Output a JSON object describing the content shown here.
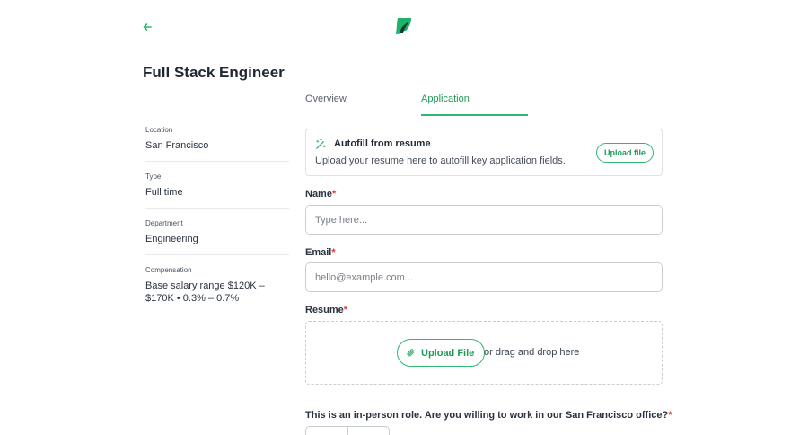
{
  "header": {
    "back_icon": "arrow-left-icon",
    "logo_icon": "brand-logo-icon",
    "accent_color": "#2eb872"
  },
  "job": {
    "title": "Full Stack Engineer"
  },
  "sidebar": {
    "sections": [
      {
        "label": "Location",
        "value": "San Francisco"
      },
      {
        "label": "Type",
        "value": "Full time"
      },
      {
        "label": "Department",
        "value": "Engineering"
      },
      {
        "label": "Compensation",
        "value": "Base salary range $120K – $170K • 0.3% – 0.7%"
      }
    ]
  },
  "tabs": [
    {
      "label": "Overview",
      "active": false
    },
    {
      "label": "Application",
      "active": true
    }
  ],
  "autofill": {
    "icon": "magic-wand-icon",
    "title": "Autofill from resume",
    "description": "Upload your resume here to autofill key application fields.",
    "button_label": "Upload file"
  },
  "form": {
    "name": {
      "label": "Name",
      "required_mark": "*",
      "placeholder": "Type here..."
    },
    "email": {
      "label": "Email",
      "required_mark": "*",
      "placeholder": "hello@example.com..."
    },
    "resume": {
      "label": "Resume",
      "required_mark": "*",
      "button_label": "Upload File",
      "button_icon": "paperclip-icon",
      "drag_text": "or drag and drop here"
    },
    "in_person": {
      "question": "This is an in-person role. Are you willing to work in our San Francisco office?",
      "required_mark": "*"
    }
  }
}
